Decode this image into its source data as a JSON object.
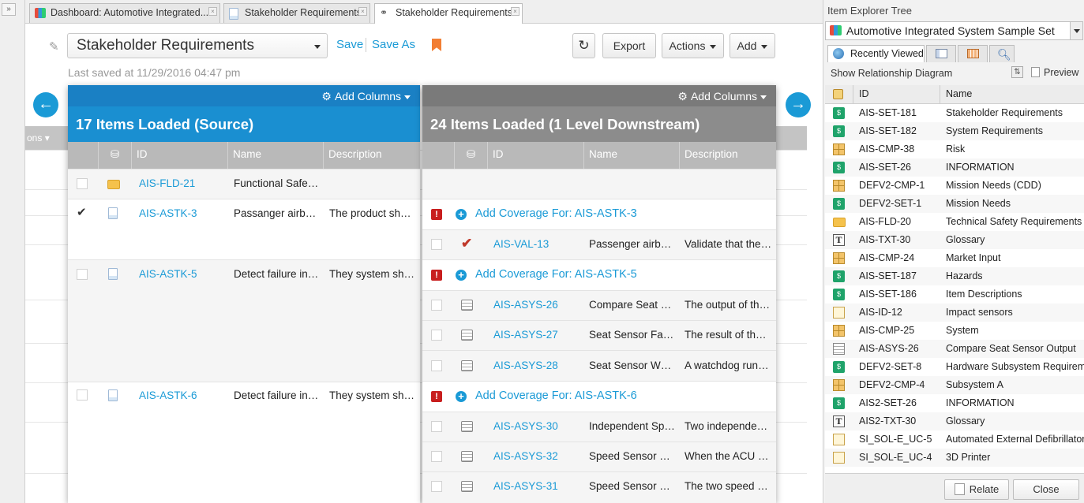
{
  "tabs": [
    {
      "label": "Dashboard: Automotive Integrated...",
      "icon": "dashboard-icon"
    },
    {
      "label": "Stakeholder Requirements",
      "icon": "document-icon"
    },
    {
      "label": "Stakeholder Requirements",
      "icon": "trace-icon"
    }
  ],
  "header": {
    "view_name": "Stakeholder Requirements",
    "save": "Save",
    "save_as": "Save As",
    "last_saved": "Last saved at 11/29/2016 04:47 pm",
    "export": "Export",
    "actions": "Actions",
    "add": "Add"
  },
  "background": {
    "col_label": "ons"
  },
  "source": {
    "add_columns": "Add Columns",
    "title": "17 Items Loaded (Source)",
    "columns": [
      "ID",
      "Name",
      "Description"
    ],
    "rows": [
      {
        "id": "AIS-FLD-21",
        "name": "Functional Safe…",
        "desc": "",
        "checked": false,
        "icon": "folder-icon"
      },
      {
        "id": "AIS-ASTK-3",
        "name": "Passanger airb…",
        "desc": "The product sh…",
        "checked": true,
        "icon": "document-icon"
      },
      {
        "id": "AIS-ASTK-5",
        "name": "Detect failure in…",
        "desc": "They system sh…",
        "checked": false,
        "icon": "document-icon"
      },
      {
        "id": "AIS-ASTK-6",
        "name": "Detect failure in…",
        "desc": "They system sh…",
        "checked": false,
        "icon": "document-icon"
      }
    ]
  },
  "downstream": {
    "add_columns": "Add Columns",
    "title": "24 Items Loaded (1 Level Downstream)",
    "columns": [
      "ID",
      "Name",
      "Description"
    ],
    "coverage": [
      "Add Coverage For: AIS-ASTK-3",
      "Add Coverage For: AIS-ASTK-5",
      "Add Coverage For: AIS-ASTK-6"
    ],
    "rows": [
      {
        "id": "AIS-VAL-13",
        "name": "Passenger airb…",
        "desc": "Validate that the…",
        "icon": "validation-check-icon"
      },
      {
        "id": "AIS-ASYS-26",
        "name": "Compare Seat …",
        "desc": "The output of th…",
        "icon": "system-requirement-icon"
      },
      {
        "id": "AIS-ASYS-27",
        "name": "Seat Sensor Fa…",
        "desc": "The result of th…",
        "icon": "system-requirement-icon"
      },
      {
        "id": "AIS-ASYS-28",
        "name": "Seat Sensor W…",
        "desc": "A watchdog run…",
        "icon": "system-requirement-icon"
      },
      {
        "id": "AIS-ASYS-30",
        "name": "Independent Sp…",
        "desc": "Two independe…",
        "icon": "system-requirement-icon"
      },
      {
        "id": "AIS-ASYS-32",
        "name": "Speed Sensor …",
        "desc": "When the ACU …",
        "icon": "system-requirement-icon"
      },
      {
        "id": "AIS-ASYS-31",
        "name": "Speed Sensor …",
        "desc": "The two speed …",
        "icon": "system-requirement-icon"
      }
    ]
  },
  "explorer": {
    "title": "Item Explorer Tree",
    "set": "Automotive Integrated System Sample Set",
    "tab_recent": "Recently Viewed",
    "show_rel": "Show Relationship Diagram",
    "preview": "Preview",
    "col_id": "ID",
    "col_name": "Name",
    "items": [
      {
        "id": "AIS-SET-181",
        "name": "Stakeholder Requirements",
        "type": "set"
      },
      {
        "id": "AIS-SET-182",
        "name": "System Requirements",
        "type": "set"
      },
      {
        "id": "AIS-CMP-38",
        "name": "Risk",
        "type": "cmp"
      },
      {
        "id": "AIS-SET-26",
        "name": "INFORMATION",
        "type": "set"
      },
      {
        "id": "DEFV2-CMP-1",
        "name": "Mission Needs (CDD)",
        "type": "cmp"
      },
      {
        "id": "DEFV2-SET-1",
        "name": "Mission Needs",
        "type": "set"
      },
      {
        "id": "AIS-FLD-20",
        "name": "Technical Safety Requirements (",
        "type": "fld"
      },
      {
        "id": "AIS-TXT-30",
        "name": "Glossary",
        "type": "txt"
      },
      {
        "id": "AIS-CMP-24",
        "name": "Market Input",
        "type": "cmp"
      },
      {
        "id": "AIS-SET-187",
        "name": "Hazards",
        "type": "set"
      },
      {
        "id": "AIS-SET-186",
        "name": "Item Descriptions",
        "type": "set"
      },
      {
        "id": "AIS-ID-12",
        "name": "Impact sensors",
        "type": "id"
      },
      {
        "id": "AIS-CMP-25",
        "name": "System",
        "type": "cmp"
      },
      {
        "id": "AIS-ASYS-26",
        "name": "Compare Seat Sensor Output",
        "type": "req"
      },
      {
        "id": "DEFV2-SET-8",
        "name": "Hardware Subsystem Requireme",
        "type": "set"
      },
      {
        "id": "DEFV2-CMP-4",
        "name": "Subsystem A",
        "type": "cmp"
      },
      {
        "id": "AIS2-SET-26",
        "name": "INFORMATION",
        "type": "set"
      },
      {
        "id": "AIS2-TXT-30",
        "name": "Glossary",
        "type": "txt"
      },
      {
        "id": "SI_SOL-E_UC-5",
        "name": "Automated External Defibrillator",
        "type": "id"
      },
      {
        "id": "SI_SOL-E_UC-4",
        "name": "3D Printer",
        "type": "id"
      }
    ],
    "relate": "Relate",
    "close": "Close"
  },
  "colors": {
    "accent": "#1a9ad6",
    "source_header": "#1a8fd1",
    "downstream_header": "#8c8c8c",
    "bookmark": "#f27e33",
    "warning": "#c81e1e"
  }
}
